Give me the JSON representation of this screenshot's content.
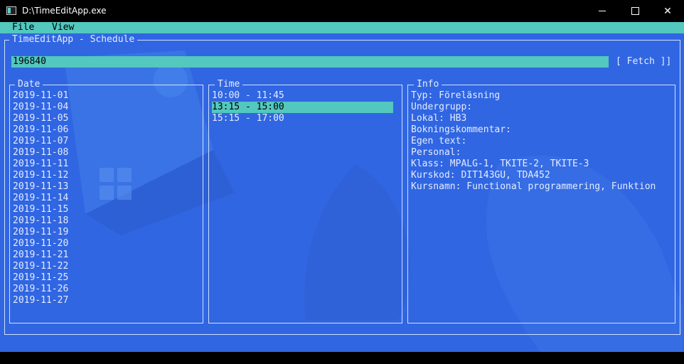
{
  "window": {
    "title": "D:\\TimeEditApp.exe"
  },
  "menu": {
    "items": [
      "File",
      "View"
    ]
  },
  "main": {
    "title": "TimeEditApp - Schedule"
  },
  "search": {
    "value": "196840",
    "fetch_label": "[ Fetch ]]"
  },
  "date_panel": {
    "title": "Date",
    "items": [
      "2019-11-01",
      "2019-11-04",
      "2019-11-05",
      "2019-11-06",
      "2019-11-07",
      "2019-11-08",
      "2019-11-11",
      "2019-11-12",
      "2019-11-13",
      "2019-11-14",
      "2019-11-15",
      "2019-11-18",
      "2019-11-19",
      "2019-11-20",
      "2019-11-21",
      "2019-11-22",
      "2019-11-25",
      "2019-11-26",
      "2019-11-27"
    ]
  },
  "time_panel": {
    "title": "Time",
    "items": [
      "10:00 - 11:45",
      "13:15 - 15:00",
      "15:15 - 17:00"
    ],
    "selected_index": 1
  },
  "info_panel": {
    "title": "Info",
    "lines": [
      "Typ: Föreläsning",
      "Undergrupp:",
      "Lokal: HB3",
      "Bokningskommentar:",
      "Egen text:",
      "Personal:",
      "Klass: MPALG-1, TKITE-2, TKITE-3",
      "Kurskod: DIT143GU, TDA452",
      "Kursnamn: Functional programmering, Funktion"
    ]
  },
  "colors": {
    "background": "#3166e2",
    "accent": "#52c8bf",
    "text": "#e4ecff"
  }
}
